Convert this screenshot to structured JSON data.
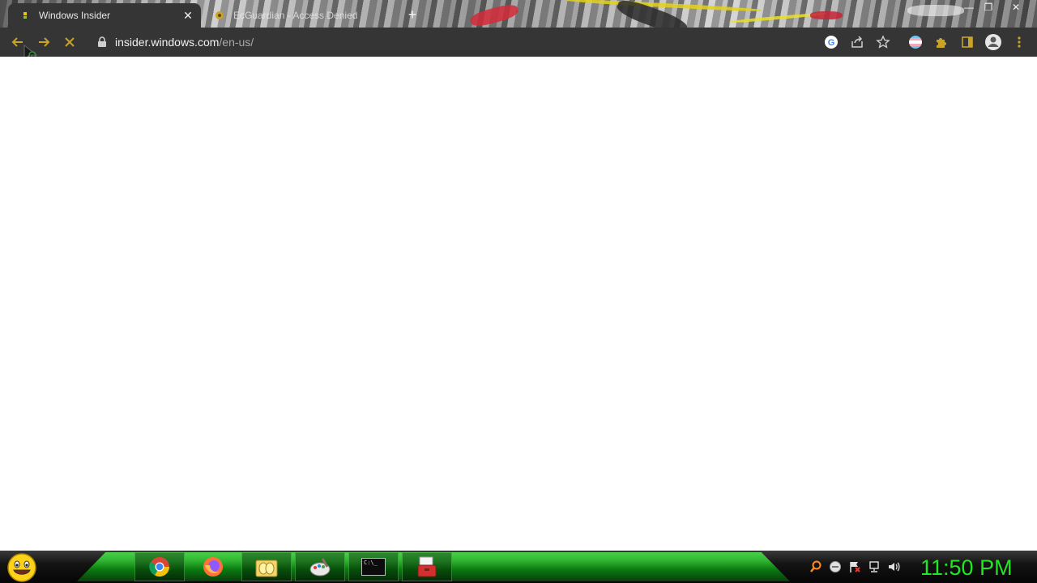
{
  "browser": {
    "tabs": [
      {
        "title": "Windows Insider",
        "active": true,
        "favicon": "loading-favicon-icon"
      },
      {
        "title": "EcGuardian - Access Denied",
        "active": false,
        "favicon": "ecguardian-favicon-icon"
      }
    ],
    "new_tab_symbol": "+",
    "close_tab_symbol": "✕",
    "window_controls": {
      "minimize": "—",
      "restore": "❐",
      "close": "✕"
    },
    "address_bar": {
      "host": "insider.windows.com",
      "path": "/en-us/",
      "secure_icon": "lock-icon"
    },
    "toolbar_icons": [
      "back-icon",
      "forward-icon",
      "stop-loading-icon",
      "google-icon",
      "share-icon",
      "bookmark-star-icon",
      "flag-extension-icon",
      "extensions-puzzle-icon",
      "side-panel-icon",
      "profile-icon",
      "menu-kebab-icon"
    ]
  },
  "taskbar": {
    "apps": [
      "chrome-icon",
      "firefox-icon",
      "file-explorer-icon",
      "paint-icon",
      "command-prompt-icon",
      "toolbox-icon"
    ],
    "tray_icons": [
      "search-icon",
      "update-icon",
      "action-center-flag-icon",
      "network-icon",
      "volume-icon"
    ],
    "clock": "11:50 PM",
    "cmd_icon_text": "C:\\_"
  },
  "colors": {
    "toolbar_bg": "#353535",
    "accent_gold": "#c9a227",
    "clock_green": "#22e622",
    "taskbar_green": "#2fb330"
  }
}
